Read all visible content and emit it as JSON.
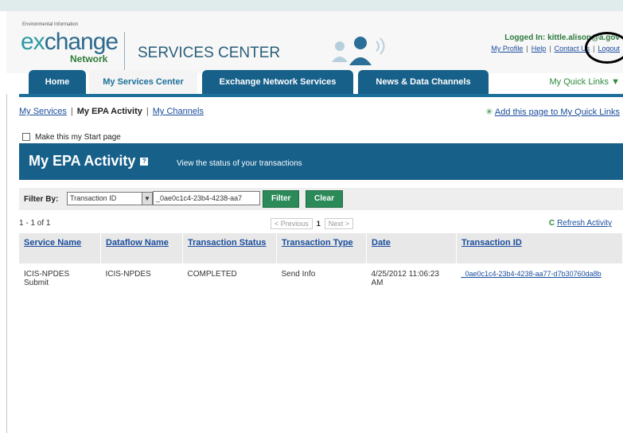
{
  "header": {
    "logo_top": "Environmental Information",
    "logo_main": "change",
    "logo_prefix": "ex",
    "logo_sub": "Network",
    "services_center": "SERVICES CENTER",
    "logged_in": "Logged In: kittle.alison@",
    "logged_domain": "a.gov",
    "links": [
      "My Profile",
      "Help",
      "Contact Us",
      "Logout"
    ]
  },
  "nav": {
    "tabs": [
      "Home",
      "My Services Center",
      "Exchange Network Services",
      "News & Data Channels"
    ],
    "quick_links": "My Quick Links"
  },
  "subnav": {
    "items": [
      "My Services",
      "My EPA Activity",
      "My Channels"
    ],
    "add_page": "Add this page to My Quick Links"
  },
  "start_page": "Make this my Start page",
  "banner": {
    "title": "My EPA Activity",
    "help_glyph": "?",
    "description": "View the status of your transactions"
  },
  "filter": {
    "label": "Filter By:",
    "select_value": "Transaction ID",
    "input_value": "_0ae0c1c4-23b4-4238-aa7",
    "filter_button": "Filter",
    "clear_button": "Clear"
  },
  "results": {
    "count": "1 - 1 of 1",
    "previous": "< Previous",
    "page": "1",
    "next": "Next >",
    "refresh": "Refresh Activity"
  },
  "table": {
    "headers": [
      "Service Name",
      "Dataflow Name",
      "Transaction Status",
      "Transaction Type",
      "Date",
      "Transaction ID"
    ],
    "rows": [
      {
        "service": "ICIS-NPDES Submit",
        "dataflow": "ICIS-NPDES",
        "status": "COMPLETED",
        "type": "Send Info",
        "date": "4/25/2012 11:06:23 AM",
        "transaction_id": "_0ae0c1c4-23b4-4238-aa77-d7b30760da8b"
      }
    ]
  },
  "colors": {
    "primary_blue": "#17608a",
    "green": "#2c8a59",
    "link": "#1a4d9c"
  }
}
